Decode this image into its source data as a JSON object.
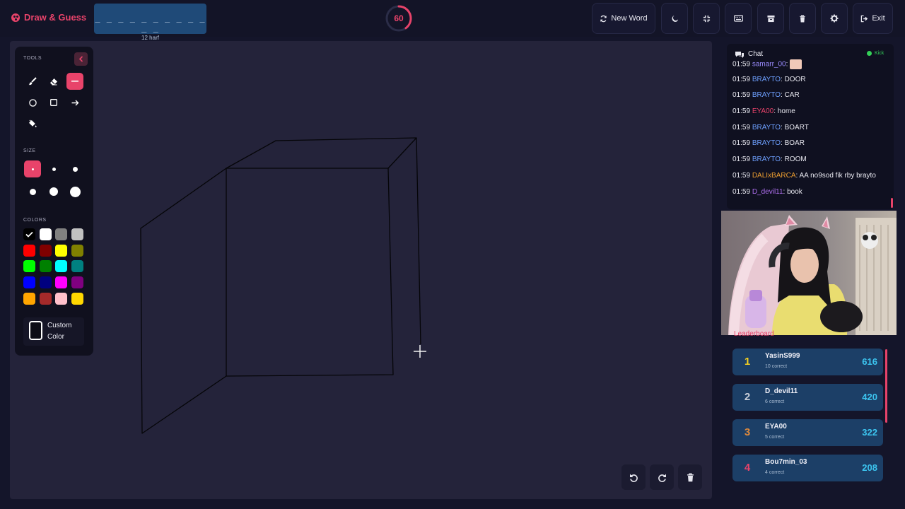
{
  "app": {
    "title": "Draw & Guess"
  },
  "word": {
    "masked": "_ _ _ _ _ _ _ _ _ _ _ _",
    "hint": "12 harf"
  },
  "timer": {
    "seconds": "60",
    "fraction_remaining": 0.4
  },
  "toolbar": {
    "new_word_label": "New Word",
    "exit_label": "Exit",
    "icons": [
      "moon-icon",
      "compress-icon",
      "keyboard-icon",
      "archive-icon",
      "trash-icon",
      "gear-icon"
    ]
  },
  "tools": {
    "title": "TOOLS",
    "size_title": "SIZE",
    "colors_title": "COLORS",
    "items": [
      "brush",
      "eraser",
      "line",
      "circle",
      "rectangle",
      "arrow",
      "fill"
    ],
    "active": "line",
    "sizes_active": 0,
    "custom_color_label": "Custom Color",
    "colors": [
      "#000000",
      "#ffffff",
      "#808080",
      "#c0c0c0",
      "#ff0000",
      "#800000",
      "#ffff00",
      "#808000",
      "#00ff00",
      "#008000",
      "#00ffff",
      "#008080",
      "#0000ff",
      "#000080",
      "#ff00ff",
      "#800080",
      "#ffa500",
      "#a52a2a",
      "#ffc0cb",
      "#ffd700"
    ],
    "selected_color": "#000000"
  },
  "chat": {
    "title": "Chat",
    "kick_label": "Kick",
    "messages": [
      {
        "time": "01:59",
        "user": "samarr_00",
        "text": "",
        "color": "#9b8cff",
        "emote": true
      },
      {
        "time": "01:59",
        "user": "BRAYTO",
        "text": ": DOOR",
        "color": "#6ea0ff"
      },
      {
        "time": "01:59",
        "user": "BRAYTO",
        "text": ": CAR",
        "color": "#6ea0ff"
      },
      {
        "time": "01:59",
        "user": "EYA00",
        "text": ": home",
        "color": "#e8436a"
      },
      {
        "time": "01:59",
        "user": "BRAYTO",
        "text": ": BOART",
        "color": "#6ea0ff"
      },
      {
        "time": "01:59",
        "user": "BRAYTO",
        "text": ": BOAR",
        "color": "#6ea0ff"
      },
      {
        "time": "01:59",
        "user": "BRAYTO",
        "text": ": ROOM",
        "color": "#6ea0ff"
      },
      {
        "time": "01:59",
        "user": "DALIxBARCA",
        "text": ": AA no9sod fik rby brayto",
        "color": "#f0a030"
      },
      {
        "time": "01:59",
        "user": "D_devil11",
        "text": ": book",
        "color": "#b070f0"
      }
    ]
  },
  "leaderboard": {
    "title": "Leaderboard",
    "entries": [
      {
        "rank": "1",
        "name": "YasinS999",
        "correct": "10 correct",
        "score": "616",
        "rank_color": "#f5d020"
      },
      {
        "rank": "2",
        "name": "D_devil11",
        "correct": "6 correct",
        "score": "420",
        "rank_color": "#c8cdd8"
      },
      {
        "rank": "3",
        "name": "EYA00",
        "correct": "5 correct",
        "score": "322",
        "rank_color": "#e08a3c"
      },
      {
        "rank": "4",
        "name": "Bou7min_03",
        "correct": "4 correct",
        "score": "208",
        "rank_color": "#e8436a"
      }
    ]
  },
  "colors": {
    "accent": "#e8436a",
    "panel": "#10101e",
    "canvas": "#24233a",
    "lb_row": "#1c3f67",
    "score": "#3cc5f0"
  }
}
